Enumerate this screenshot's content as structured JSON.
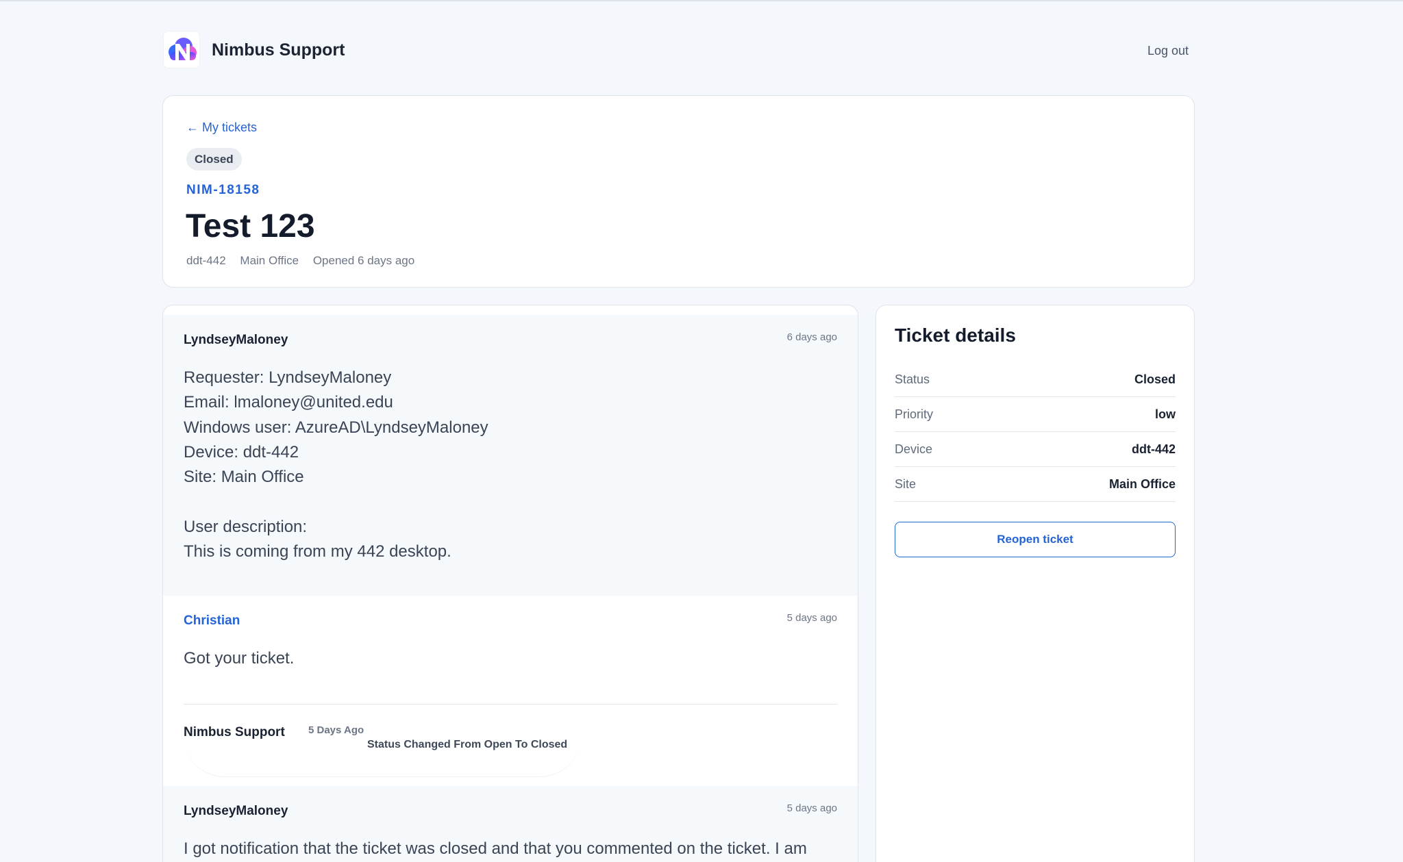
{
  "brand": {
    "name": "Nimbus Support"
  },
  "nav": {
    "logout_label": "Log out"
  },
  "ticket": {
    "back_label": "← My tickets",
    "status": "Closed",
    "id": "NIM-18158",
    "title": "Test 123",
    "meta": [
      "ddt-442",
      "Main Office",
      "Opened 6 days ago"
    ]
  },
  "messages": [
    {
      "author": "LyndseyMaloney",
      "time": "6 days ago",
      "lines": [
        "Requester: LyndseyMaloney",
        "Email: lmaloney@united.edu",
        "Windows user: AzureAD\\LyndseyMaloney",
        "Device: ddt-442",
        "Site: Main Office",
        "",
        "User description:",
        "This is coming from my 442 desktop."
      ]
    },
    {
      "author": "Christian",
      "time": "5 days ago",
      "lines": [
        "Got your ticket."
      ]
    },
    {
      "author": "LyndseyMaloney",
      "time": "5 days ago",
      "lines": [
        "I got notification that the ticket was closed and that you commented on the ticket. I am"
      ]
    }
  ],
  "status_event": {
    "author": "Nimbus Support",
    "time": "5 Days Ago",
    "text": "Status Changed From Open To Closed"
  },
  "details": {
    "title": "Ticket details",
    "rows": [
      {
        "label": "Status",
        "value": "Closed"
      },
      {
        "label": "Priority",
        "value": "low"
      },
      {
        "label": "Device",
        "value": "ddt-442"
      },
      {
        "label": "Site",
        "value": "Main Office"
      }
    ],
    "reopen_label": "Reopen ticket"
  },
  "colors": {
    "accent": "#2563d6",
    "background": "#f4f7fb",
    "logo_gradient_start": "#2f5bff",
    "logo_gradient_end": "#ff5fc8"
  }
}
